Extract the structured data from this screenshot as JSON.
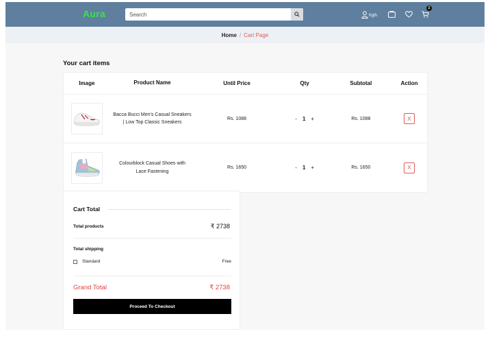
{
  "header": {
    "brand": "Aura",
    "search_placeholder": "Search",
    "user_label": "frgth",
    "cart_count": "2",
    "icons": [
      "user-icon",
      "compare-icon",
      "heart-icon",
      "cart-icon",
      "search-icon"
    ],
    "brand_color": "#3ee051",
    "bar_color": "#5f7f9e"
  },
  "breadcrumb": {
    "home": "Home",
    "separator": "/",
    "current": "Cart Page"
  },
  "cart": {
    "title": "Your cart items",
    "columns": {
      "image": "Image",
      "name": "Product Name",
      "price": "Until Price",
      "qty": "Qty",
      "subtotal": "Subtotal",
      "action": "Action"
    },
    "items": [
      {
        "name_line1": "Bacca Bucci Men's Casual Sneakers",
        "name_line2": "| Low Top Classic Sneakers",
        "price": "Rs. 1088",
        "qty_minus": "-",
        "qty": "1",
        "qty_plus": "+",
        "subtotal": "Rs. 1088",
        "remove": "X"
      },
      {
        "name_line1": "Colourblock Casual Shoes with",
        "name_line2": "Lace Fastening",
        "price": "Rs. 1650",
        "qty_minus": "-",
        "qty": "1",
        "qty_plus": "+",
        "subtotal": "Rs. 1650",
        "remove": "X"
      }
    ]
  },
  "totals": {
    "title": "Cart Total",
    "products_label": "Total products",
    "products_value": "₹ 2738",
    "shipping_label": "Total shipping",
    "shipping_option": "Standard",
    "shipping_cost": "Free",
    "grand_label": "Grand Total",
    "grand_value": "₹ 2738",
    "checkout_label": "Proceed To Checkout",
    "accent_color": "#e53e3e"
  }
}
